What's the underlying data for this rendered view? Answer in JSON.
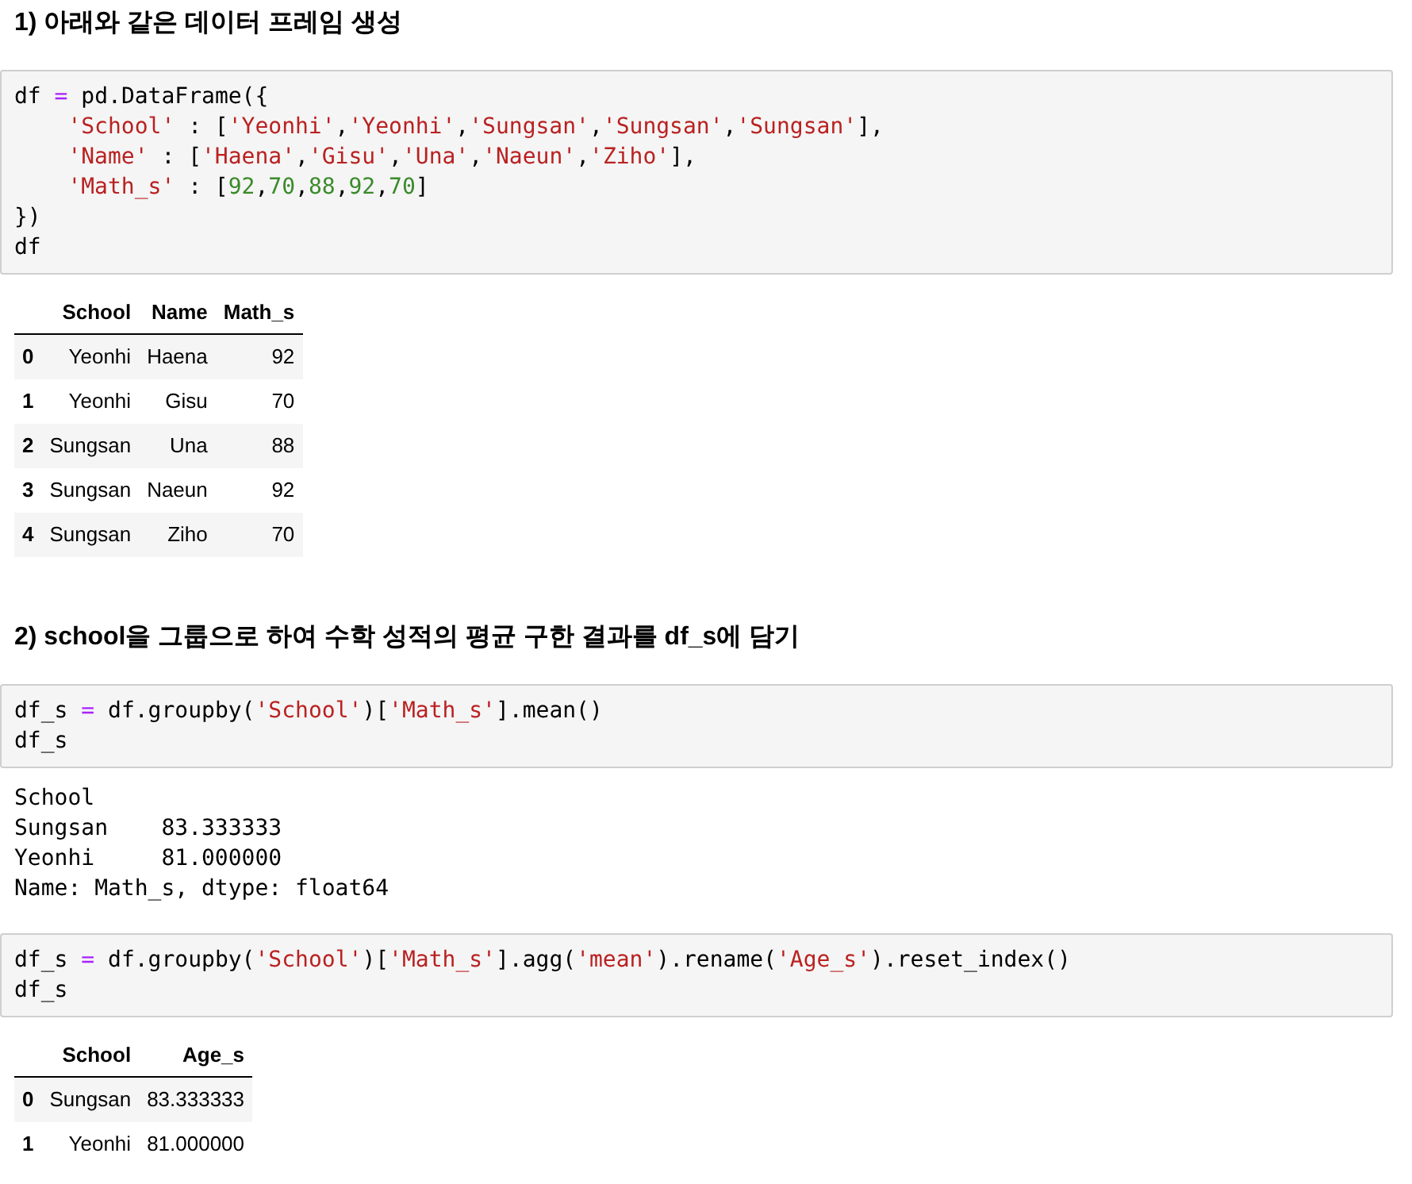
{
  "cells": [
    {
      "kind": "heading",
      "text": "1) 아래와 같은 데이터 프레임 생성"
    },
    {
      "kind": "code",
      "lines": [
        {
          "indent": false,
          "tokens": [
            {
              "t": "df ",
              "kind": "plain"
            },
            {
              "t": "=",
              "kind": "op"
            },
            {
              "t": " pd.DataFrame({",
              "kind": "plain"
            }
          ]
        },
        {
          "indent": true,
          "tokens": [
            {
              "t": "'School'",
              "kind": "str"
            },
            {
              "t": " : [",
              "kind": "plain"
            },
            {
              "t": "'Yeonhi'",
              "kind": "str"
            },
            {
              "t": ",",
              "kind": "plain"
            },
            {
              "t": "'Yeonhi'",
              "kind": "str"
            },
            {
              "t": ",",
              "kind": "plain"
            },
            {
              "t": "'Sungsan'",
              "kind": "str"
            },
            {
              "t": ",",
              "kind": "plain"
            },
            {
              "t": "'Sungsan'",
              "kind": "str"
            },
            {
              "t": ",",
              "kind": "plain"
            },
            {
              "t": "'Sungsan'",
              "kind": "str"
            },
            {
              "t": "],",
              "kind": "plain"
            }
          ]
        },
        {
          "indent": true,
          "tokens": [
            {
              "t": "'Name'",
              "kind": "str"
            },
            {
              "t": " : [",
              "kind": "plain"
            },
            {
              "t": "'Haena'",
              "kind": "str"
            },
            {
              "t": ",",
              "kind": "plain"
            },
            {
              "t": "'Gisu'",
              "kind": "str"
            },
            {
              "t": ",",
              "kind": "plain"
            },
            {
              "t": "'Una'",
              "kind": "str"
            },
            {
              "t": ",",
              "kind": "plain"
            },
            {
              "t": "'Naeun'",
              "kind": "str"
            },
            {
              "t": ",",
              "kind": "plain"
            },
            {
              "t": "'Ziho'",
              "kind": "str"
            },
            {
              "t": "],",
              "kind": "plain"
            }
          ]
        },
        {
          "indent": true,
          "tokens": [
            {
              "t": "'Math_s'",
              "kind": "str"
            },
            {
              "t": " : [",
              "kind": "plain"
            },
            {
              "t": "92",
              "kind": "num"
            },
            {
              "t": ",",
              "kind": "plain"
            },
            {
              "t": "70",
              "kind": "num"
            },
            {
              "t": ",",
              "kind": "plain"
            },
            {
              "t": "88",
              "kind": "num"
            },
            {
              "t": ",",
              "kind": "plain"
            },
            {
              "t": "92",
              "kind": "num"
            },
            {
              "t": ",",
              "kind": "plain"
            },
            {
              "t": "70",
              "kind": "num"
            },
            {
              "t": "]",
              "kind": "plain"
            }
          ]
        },
        {
          "indent": false,
          "tokens": [
            {
              "t": "})",
              "kind": "plain"
            }
          ]
        },
        {
          "indent": false,
          "tokens": [
            {
              "t": "df",
              "kind": "plain"
            }
          ]
        }
      ]
    },
    {
      "kind": "table",
      "columns": [
        "School",
        "Name",
        "Math_s"
      ],
      "rows": [
        {
          "index": "0",
          "cells": [
            "Yeonhi",
            "Haena",
            "92"
          ]
        },
        {
          "index": "1",
          "cells": [
            "Yeonhi",
            "Gisu",
            "70"
          ]
        },
        {
          "index": "2",
          "cells": [
            "Sungsan",
            "Una",
            "88"
          ]
        },
        {
          "index": "3",
          "cells": [
            "Sungsan",
            "Naeun",
            "92"
          ]
        },
        {
          "index": "4",
          "cells": [
            "Sungsan",
            "Ziho",
            "70"
          ]
        }
      ]
    },
    {
      "kind": "heading",
      "text": "2) school을 그룹으로 하여 수학 성적의 평균 구한 결과를 df_s에 담기"
    },
    {
      "kind": "code",
      "lines": [
        {
          "indent": false,
          "tokens": [
            {
              "t": "df_s ",
              "kind": "plain"
            },
            {
              "t": "=",
              "kind": "op"
            },
            {
              "t": " df.groupby(",
              "kind": "plain"
            },
            {
              "t": "'School'",
              "kind": "str"
            },
            {
              "t": ")[",
              "kind": "plain"
            },
            {
              "t": "'Math_s'",
              "kind": "str"
            },
            {
              "t": "].mean()",
              "kind": "plain"
            }
          ]
        },
        {
          "indent": false,
          "tokens": [
            {
              "t": "df_s",
              "kind": "plain"
            }
          ]
        }
      ]
    },
    {
      "kind": "output",
      "lines": [
        "School",
        "Sungsan    83.333333",
        "Yeonhi     81.000000",
        "Name: Math_s, dtype: float64"
      ]
    },
    {
      "kind": "code",
      "lines": [
        {
          "indent": false,
          "tokens": [
            {
              "t": "df_s ",
              "kind": "plain"
            },
            {
              "t": "=",
              "kind": "op"
            },
            {
              "t": " df.groupby(",
              "kind": "plain"
            },
            {
              "t": "'School'",
              "kind": "str"
            },
            {
              "t": ")[",
              "kind": "plain"
            },
            {
              "t": "'Math_s'",
              "kind": "str"
            },
            {
              "t": "].agg(",
              "kind": "plain"
            },
            {
              "t": "'mean'",
              "kind": "str"
            },
            {
              "t": ").rename(",
              "kind": "plain"
            },
            {
              "t": "'Age_s'",
              "kind": "str"
            },
            {
              "t": ").reset_index()",
              "kind": "plain"
            }
          ]
        },
        {
          "indent": false,
          "tokens": [
            {
              "t": "df_s",
              "kind": "plain"
            }
          ]
        }
      ]
    },
    {
      "kind": "table",
      "columns": [
        "School",
        "Age_s"
      ],
      "rows": [
        {
          "index": "0",
          "cells": [
            "Sungsan",
            "83.333333"
          ]
        },
        {
          "index": "1",
          "cells": [
            "Yeonhi",
            "81.000000"
          ]
        }
      ]
    }
  ]
}
